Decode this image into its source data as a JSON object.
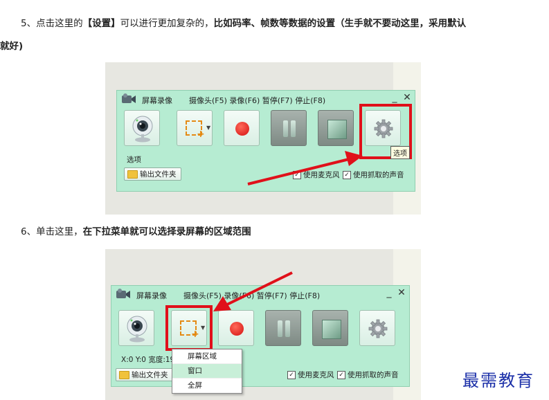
{
  "step5": {
    "num": "5、",
    "pre": "点击这里的",
    "bold1": "【设置】",
    "mid": "可以进行更加复杂的，",
    "bold2": "比如码率、帧数等数据的设置（生手就不要动这里，采用默认",
    "bold3": "就好)"
  },
  "step6": {
    "num": "6、",
    "pre": "单击这里，",
    "bold1": "在下拉菜单就可以选择录屏幕的区域范围"
  },
  "recorder": {
    "title": "屏幕录像",
    "shortcuts": "摄像头(F5) 录像(F6) 暂停(F7) 停止(F8)",
    "minimize": "_",
    "close": "✕",
    "cam_label": "选项",
    "coords_label": "X:0 Y:0 宽度:19",
    "folder_button": "输出文件夹",
    "use_mic": "使用麦克风",
    "use_sound": "使用抓取的声音",
    "check_mark": "✓",
    "tooltip": "选项"
  },
  "menu": {
    "items": [
      "屏幕区域",
      "窗口",
      "全屏"
    ],
    "selected": "窗口"
  },
  "icons": [
    "folder-icon",
    "webcam-icon",
    "region-icon",
    "record-icon",
    "pause-icon",
    "stop-icon",
    "gear-icon",
    "arrow-icon"
  ],
  "colors": {
    "highlight": "#e0101a",
    "recorder_bg": "#b6ecd2",
    "brand": "#1b2fa8"
  },
  "brand": "最需教育"
}
